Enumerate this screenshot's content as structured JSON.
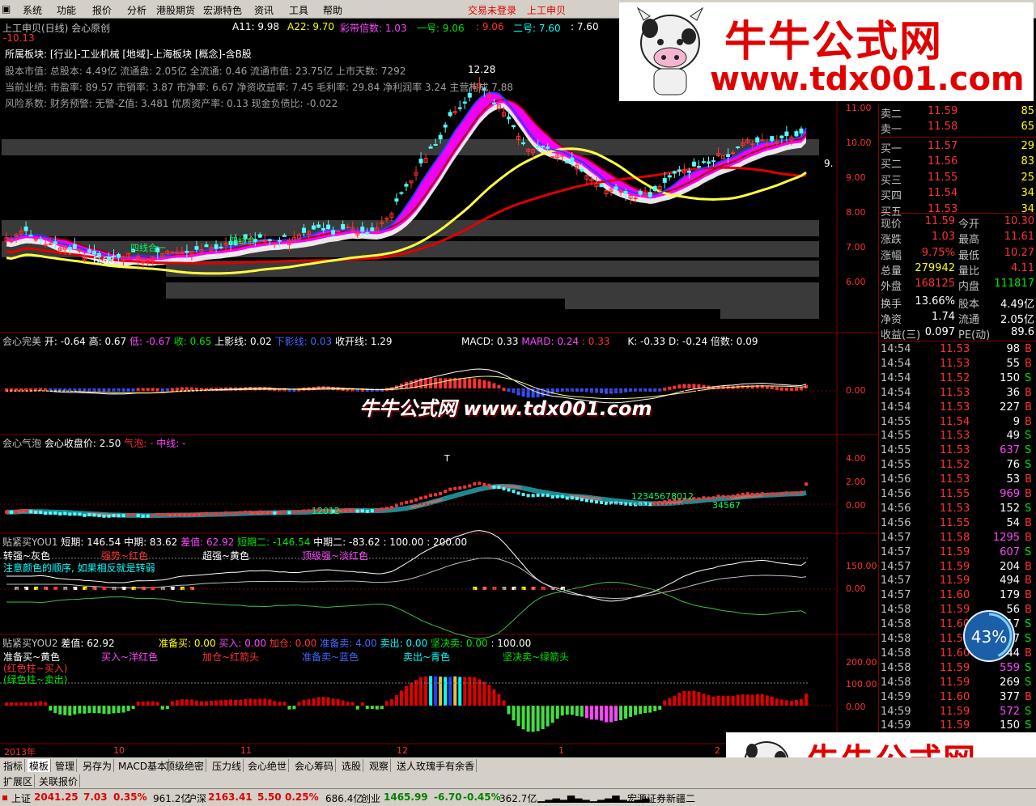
{
  "menu": {
    "items": [
      "系统",
      "功能",
      "报价",
      "分析",
      "港股期货",
      "宏源特色",
      "资讯",
      "工具",
      "帮助"
    ],
    "login_status": "交易未登录",
    "stock_short": "上工申贝"
  },
  "header": {
    "title": "上工申贝(日线) 会心原创",
    "a11": "A11: 9.98",
    "a22": "A22: 9.70",
    "caidai": "彩带倍数: 1.03",
    "yihao": "一号: 9.06",
    "val1": ": 9.06",
    "erhao": "二号: 7.60",
    "val2": ": 7.60",
    "neg": "-10.13"
  },
  "info_lines": [
    "所属板块: [行业]-工业机械 [地域]-上海板块 [概念]-含B股",
    "股本市值: 总股本: 4.49亿 流通盘: 2.05亿 全流通: 0.46 流通市值: 23.75亿 上市天数: 7292",
    "当前业绩: 市盈率: 89.57 市销率: 3.87 市净率: 6.67 净资收益率: 7.45 毛利率: 29.84 净利润率 3.24 主营构成 7.88",
    "风险系数: 财务预警: 无警-Z值: 3.481 优质资产率: 0.13 现金负债比: -0.022"
  ],
  "main_chart": {
    "peak_label": "12.28",
    "low_label": "6.63",
    "price_label": "9.",
    "tags": [
      "四线合一",
      "四线合一"
    ],
    "y_ticks": [
      "11.00",
      "10.00",
      "9.00",
      "8.00",
      "7.00",
      "6.00"
    ]
  },
  "panel_macd": {
    "title": "会心完美",
    "legend": [
      "开: -0.64",
      "高: 0.67",
      "低: -0.67",
      "收: 0.65",
      "上影线: 0.02",
      "下影线: 0.03",
      "收开线: 1.29",
      "MACD: 0.33",
      "MARD: 0.24",
      ": 0.33",
      "K: -0.33",
      "D: -0.24",
      "倍数: 0.09"
    ],
    "y_tick": "0.00"
  },
  "panel_bubble": {
    "title": "会心气泡",
    "legend": [
      "会心收盘价: 2.50",
      "气泡: -",
      "中线: -"
    ],
    "y_ticks": [
      "4.00",
      "2.00",
      "0.00"
    ],
    "seq1": "12345678012",
    "seq2": "34567",
    "seq3": "12012",
    "t_mark": "T"
  },
  "panel_you1": {
    "title": "贴紧买YOU1",
    "legend": [
      "短期: 146.54",
      "中期: 83.62",
      "差值: 62.92",
      "短期二: -146.54",
      "中期二: -83.62",
      ": 100.00",
      ": 200.00"
    ],
    "notes": [
      "转强~灰色",
      "强势~红色",
      "超强~黄色",
      "顶级强~淡红色",
      "注意颜色的顺序, 如果相反就是转弱"
    ],
    "y_ticks": [
      "150.00",
      "0.00"
    ]
  },
  "panel_you2": {
    "title": "贴紧买YOU2",
    "legend": [
      "差值: 62.92",
      "准备买: 0.00",
      "买入: 0.00",
      "加仓: 0.00",
      "准备卖: 4.00",
      "卖出: 0.00",
      "坚决卖: 0.00",
      ": 100.00"
    ],
    "notes": [
      "准备买~黄色",
      "买入~洋红色",
      "加仓~红箭头",
      "准备卖~蓝色",
      "卖出~青色",
      "坚决卖~绿箭头",
      "(红色柱~买入)",
      "(绿色柱~卖出)"
    ],
    "y_ticks": [
      "200.00",
      "100.00",
      "0.00"
    ]
  },
  "time_axis": [
    "2013年",
    "10",
    "11",
    "12",
    "1",
    "2"
  ],
  "quote": {
    "sell": [
      {
        "label": "卖二",
        "price": "11.59",
        "vol": "85"
      },
      {
        "label": "卖一",
        "price": "11.58",
        "vol": "65"
      }
    ],
    "buy": [
      {
        "label": "买一",
        "price": "11.57",
        "vol": "29"
      },
      {
        "label": "买二",
        "price": "11.56",
        "vol": "83"
      },
      {
        "label": "买三",
        "price": "11.55",
        "vol": "25"
      },
      {
        "label": "买四",
        "price": "11.54",
        "vol": "34"
      },
      {
        "label": "买五",
        "price": "11.53",
        "vol": "34"
      }
    ],
    "stats": [
      [
        "现价",
        "11.59",
        "今开",
        "10.30"
      ],
      [
        "涨跌",
        "1.03",
        "最高",
        "11.61"
      ],
      [
        "涨幅",
        "9.75%",
        "最低",
        "10.27"
      ],
      [
        "总量",
        "279942",
        "量比",
        "4.11"
      ],
      [
        "外盘",
        "168125",
        "内盘",
        "111817"
      ],
      [
        "换手",
        "13.66%",
        "股本",
        "4.49亿"
      ],
      [
        "净资",
        "1.74",
        "流通",
        "2.05亿"
      ],
      [
        "收益(三)",
        "0.097",
        "PE(动)",
        "89.6"
      ]
    ],
    "ticks": [
      [
        "14:54",
        "11.53",
        "98",
        "B"
      ],
      [
        "14:54",
        "11.53",
        "55",
        "B"
      ],
      [
        "14:54",
        "11.52",
        "150",
        "S"
      ],
      [
        "14:54",
        "11.53",
        "36",
        "B"
      ],
      [
        "14:54",
        "11.53",
        "227",
        "B"
      ],
      [
        "14:55",
        "11.54",
        "9",
        "B"
      ],
      [
        "14:55",
        "11.53",
        "49",
        "S"
      ],
      [
        "14:55",
        "11.53",
        "637",
        "S"
      ],
      [
        "14:55",
        "11.52",
        "76",
        "S"
      ],
      [
        "14:56",
        "11.53",
        "53",
        "B"
      ],
      [
        "14:56",
        "11.55",
        "969",
        "B"
      ],
      [
        "14:56",
        "11.53",
        "152",
        "S"
      ],
      [
        "14:56",
        "11.55",
        "54",
        "B"
      ],
      [
        "14:57",
        "11.58",
        "1295",
        "B"
      ],
      [
        "14:57",
        "11.59",
        "607",
        "S"
      ],
      [
        "14:57",
        "11.59",
        "204",
        "B"
      ],
      [
        "14:57",
        "11.59",
        "494",
        "B"
      ],
      [
        "14:57",
        "11.60",
        "179",
        "B"
      ],
      [
        "14:58",
        "11.59",
        "56",
        "B"
      ],
      [
        "14:58",
        "11.60",
        "117",
        "S"
      ],
      [
        "14:58",
        "11.53",
        "77",
        "S"
      ],
      [
        "14:58",
        "11.60",
        "44",
        "B"
      ],
      [
        "14:58",
        "11.59",
        "559",
        "S"
      ],
      [
        "14:58",
        "11.59",
        "269",
        "S"
      ],
      [
        "14:59",
        "11.60",
        "377",
        "B"
      ],
      [
        "14:59",
        "11.59",
        "572",
        "S"
      ],
      [
        "14:59",
        "11.59",
        "150",
        "S"
      ]
    ]
  },
  "tabs": [
    "指标",
    "模板",
    "管理",
    "另存为",
    "MACD基本",
    "顶级绝密",
    "压力线",
    "会心绝世",
    "会心筹码",
    "选股",
    "观察",
    "送人玫瑰手有余香"
  ],
  "tabs_row2": [
    "扩展区",
    "关联报价"
  ],
  "status": {
    "sh_name": "上证",
    "sh_val": "2041.25",
    "sh_chg": "7.03",
    "sh_pct": "0.35%",
    "sh_amt": "961.2亿",
    "hs_name": "沪深",
    "hs_val": "2163.41",
    "hs_chg": "5.50",
    "hs_pct": "0.25%",
    "hs_amt": "686.4亿",
    "cy_name": "创业",
    "cy_val": "1465.99",
    "cy_chg": "-6.70",
    "cy_pct": "-0.45%",
    "cy_amt": "362.7亿",
    "broker": "宏源证券新疆二"
  },
  "watermark": {
    "title": "牛牛公式网",
    "url": "www.tdx001.com",
    "center": "牛牛公式网 www.tdx001.com"
  },
  "progress": {
    "label": "43%",
    "value": 43
  }
}
